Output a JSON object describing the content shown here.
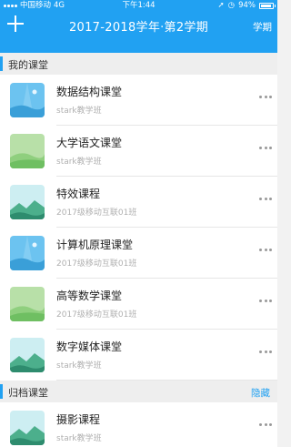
{
  "status": {
    "carrier": "中国移动",
    "network": "4G",
    "time": "下午1:44",
    "battery": "94%"
  },
  "header": {
    "title": "2017-2018学年·第2学期",
    "term_link": "学期"
  },
  "sections": {
    "mine": {
      "label": "我的课堂"
    },
    "archived": {
      "label": "归档课堂",
      "action": "隐藏"
    }
  },
  "courses": [
    {
      "name": "数据结构课堂",
      "class": "stark教学班",
      "thumbnail": "blue-gradient-rays"
    },
    {
      "name": "大学语文课堂",
      "class": "stark教学班",
      "thumbnail": "green-hills"
    },
    {
      "name": "特效课程",
      "class": "2017级移动互联01班",
      "thumbnail": "light-blue-mountains"
    },
    {
      "name": "计算机原理课堂",
      "class": "2017级移动互联01班",
      "thumbnail": "blue-gradient-rays"
    },
    {
      "name": "高等数学课堂",
      "class": "2017级移动互联01班",
      "thumbnail": "green-hills"
    },
    {
      "name": "数字媒体课堂",
      "class": "stark教学班",
      "thumbnail": "light-blue-mountains"
    }
  ],
  "archived_courses": [
    {
      "name": "摄影课程",
      "class": "stark教学班",
      "thumbnail": "light-blue-mountains"
    }
  ],
  "colors": {
    "accent": "#21a1f2",
    "background": "#f2f2f2"
  }
}
